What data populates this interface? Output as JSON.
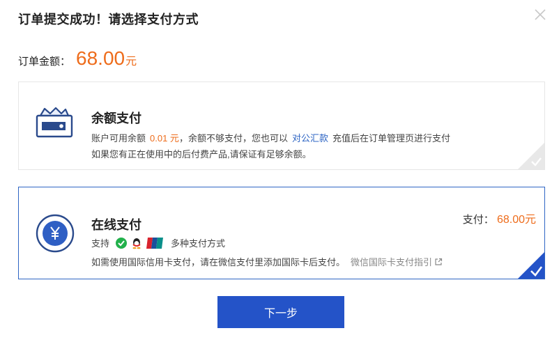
{
  "dialog": {
    "title": "订单提交成功！请选择支付方式",
    "close_icon": "close-icon"
  },
  "order": {
    "amount_label": "订单金额：",
    "amount_value": "68.00",
    "amount_unit": "元"
  },
  "balance_payment": {
    "title": "余额支付",
    "line1_prefix": "账户可用余额",
    "available_balance": "0.01 元",
    "line1_middle": "，余额不够支付，您也可以",
    "transfer_link": "对公汇款",
    "line1_suffix": "充值后在订单管理页进行支付",
    "line2": "如果您有正在使用中的后付费产品,请保证有足够余额。",
    "icon": "wallet-icon"
  },
  "online_payment": {
    "title": "在线支付",
    "pay_label": "支付：",
    "pay_amount": "68.00元",
    "support_prefix": "支持",
    "support_suffix": "多种支付方式",
    "payment_icons": [
      "wechat-pay-icon",
      "qq-wallet-icon",
      "unionpay-icon"
    ],
    "intl_notice": "如需使用国际信用卡支付，请在微信支付里添加国际卡后支付。",
    "intl_guide_link": "微信国际卡支付指引",
    "icon": "yen-icon",
    "selected": true
  },
  "actions": {
    "next_label": "下一步"
  },
  "colors": {
    "accent_orange": "#ee6c1b",
    "primary_blue": "#2453c8",
    "link_blue": "#2e65c4"
  }
}
